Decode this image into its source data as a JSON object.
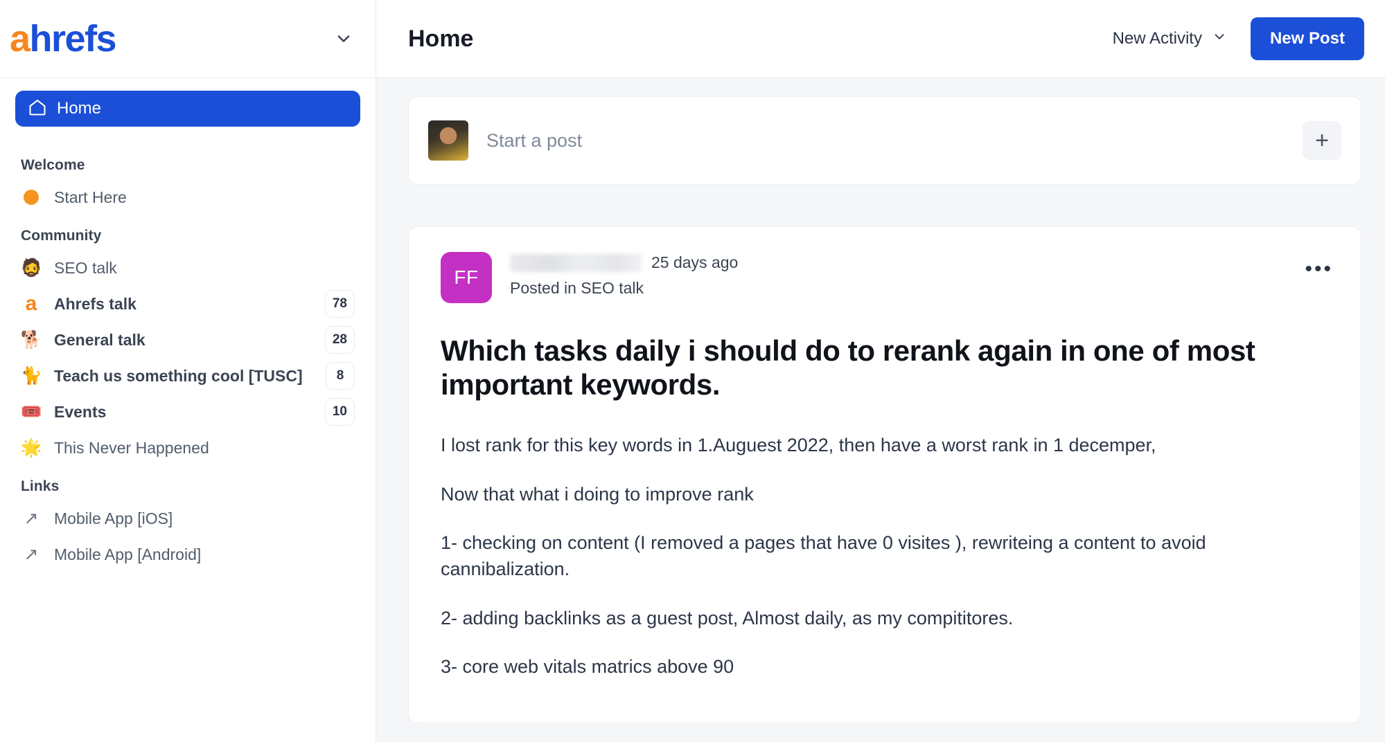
{
  "brand": {
    "logo_a": "a",
    "logo_rest": "hrefs",
    "accent_blue": "#1b4fd8",
    "accent_orange": "#f7861c"
  },
  "sidebar": {
    "workspace_chevron_icon": "chevron-down-icon",
    "home": {
      "label": "Home",
      "icon": "home-icon"
    },
    "sections": [
      {
        "title": "Welcome",
        "items": [
          {
            "label": "Start Here",
            "icon": "orange-dot-icon",
            "badge": "",
            "bold": false
          }
        ]
      },
      {
        "title": "Community",
        "items": [
          {
            "label": "SEO talk",
            "icon": "🧔",
            "badge": "",
            "bold": false
          },
          {
            "label": "Ahrefs talk",
            "icon": "ahrefs-a-icon",
            "badge": "78",
            "bold": true
          },
          {
            "label": "General talk",
            "icon": "🐕",
            "badge": "28",
            "bold": true
          },
          {
            "label": "Teach us something cool [TUSC]",
            "icon": "🐈",
            "badge": "8",
            "bold": true
          },
          {
            "label": "Events",
            "icon": "🎟️",
            "badge": "10",
            "bold": true
          },
          {
            "label": "This Never Happened",
            "icon": "🌟",
            "badge": "",
            "bold": false
          }
        ]
      },
      {
        "title": "Links",
        "items": [
          {
            "label": "Mobile App [iOS]",
            "icon": "external-link-arrow-icon",
            "badge": "",
            "bold": false
          },
          {
            "label": "Mobile App [Android]",
            "icon": "external-link-arrow-icon",
            "badge": "",
            "bold": false
          }
        ]
      }
    ]
  },
  "topbar": {
    "title": "Home",
    "activity_filter": "New Activity",
    "activity_chevron_icon": "chevron-down-icon",
    "new_post_label": "New Post"
  },
  "composer": {
    "avatar": "user-avatar-photo",
    "placeholder": "Start a post",
    "add_icon": "plus-icon"
  },
  "post": {
    "avatar_initials": "FF",
    "avatar_color": "#c42fc4",
    "author": "",
    "author_redacted": true,
    "time": "25 days ago",
    "posted_in": "Posted in SEO talk",
    "more_icon": "ellipsis-icon",
    "title": "Which tasks daily i should do to rerank again in one of most important keywords.",
    "paragraphs": [
      "I lost rank for this key words in 1.Auguest 2022, then have a worst rank in 1 decemper,",
      "Now that what i doing to improve rank",
      "1- checking on content (I removed a pages that have 0 visites ), rewriteing a content to avoid cannibalization.",
      "2- adding backlinks as a guest post, Almost daily, as my compititores.",
      "3- core web vitals matrics above 90"
    ]
  }
}
